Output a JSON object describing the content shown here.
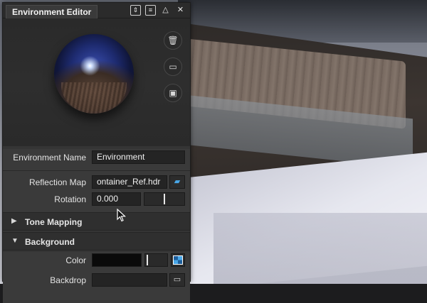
{
  "panel": {
    "title": "Environment Editor",
    "titlebar_icons": [
      "pin-icon",
      "menu-icon",
      "collapse-icon",
      "close-icon"
    ],
    "preview_buttons": [
      "delete-icon",
      "open-folder-icon",
      "save-icon"
    ]
  },
  "fields": {
    "environment_name_label": "Environment Name",
    "environment_name_value": "Environment",
    "reflection_map_label": "Reflection Map",
    "reflection_map_value": "ontainer_Ref.hdr",
    "rotation_label": "Rotation",
    "rotation_value": "0.000",
    "rotation_fraction": 0.5
  },
  "groups": {
    "tone_mapping": {
      "label": "Tone Mapping",
      "expanded": false
    },
    "background": {
      "label": "Background",
      "expanded": true
    }
  },
  "background": {
    "color_label": "Color",
    "color_value": "#0a0a0a",
    "backdrop_label": "Backdrop",
    "backdrop_value": ""
  },
  "colors": {
    "panel_bg": "#353535",
    "accent_blue": "#49a7e8"
  }
}
